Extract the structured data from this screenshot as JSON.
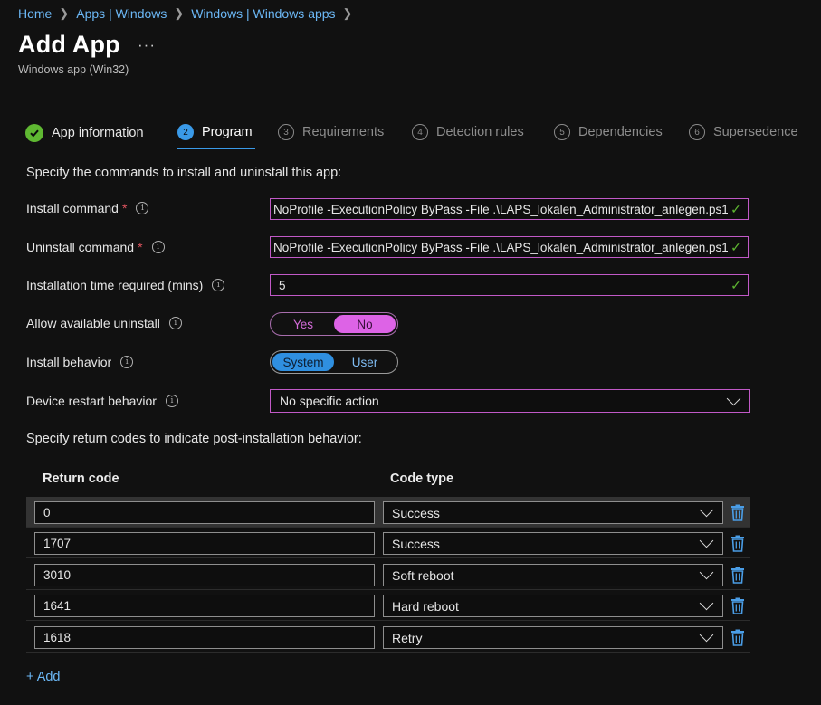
{
  "breadcrumb": [
    "Home",
    "Apps | Windows",
    "Windows | Windows apps"
  ],
  "page": {
    "title": "Add App",
    "more": "···",
    "subtitle": "Windows app (Win32)"
  },
  "steps": [
    {
      "num": "",
      "label": "App information",
      "state": "done"
    },
    {
      "num": "2",
      "label": "Program",
      "state": "active"
    },
    {
      "num": "3",
      "label": "Requirements",
      "state": "pending"
    },
    {
      "num": "4",
      "label": "Detection rules",
      "state": "pending"
    },
    {
      "num": "5",
      "label": "Dependencies",
      "state": "pending"
    },
    {
      "num": "6",
      "label": "Supersedence",
      "state": "pending"
    }
  ],
  "form": {
    "section_title": "Specify the commands to install and uninstall this app:",
    "install_label": "Install command",
    "install_value": "NoProfile -ExecutionPolicy ByPass -File .\\LAPS_lokalen_Administrator_anlegen.ps1",
    "uninstall_label": "Uninstall command",
    "uninstall_value": "NoProfile -ExecutionPolicy ByPass -File .\\LAPS_lokalen_Administrator_anlegen.ps1",
    "time_label": "Installation time required (mins)",
    "time_value": "5",
    "allow_uninstall_label": "Allow available uninstall",
    "allow_yes": "Yes",
    "allow_no": "No",
    "behavior_label": "Install behavior",
    "behavior_system": "System",
    "behavior_user": "User",
    "restart_label": "Device restart behavior",
    "restart_value": "No specific action",
    "required_mark": "*",
    "info_glyph": "i",
    "check_glyph": "✓"
  },
  "return_codes": {
    "title": "Specify return codes to indicate post-installation behavior:",
    "col_code": "Return code",
    "col_type": "Code type",
    "rows": [
      {
        "code": "0",
        "type": "Success"
      },
      {
        "code": "1707",
        "type": "Success"
      },
      {
        "code": "3010",
        "type": "Soft reboot"
      },
      {
        "code": "1641",
        "type": "Hard reboot"
      },
      {
        "code": "1618",
        "type": "Retry"
      }
    ],
    "add_label": "+ Add"
  },
  "colors": {
    "accent": "#3a9ae8",
    "link": "#6cb8f6",
    "success": "#5fb832",
    "field_border": "#c159c7",
    "required": "#e0545f"
  }
}
